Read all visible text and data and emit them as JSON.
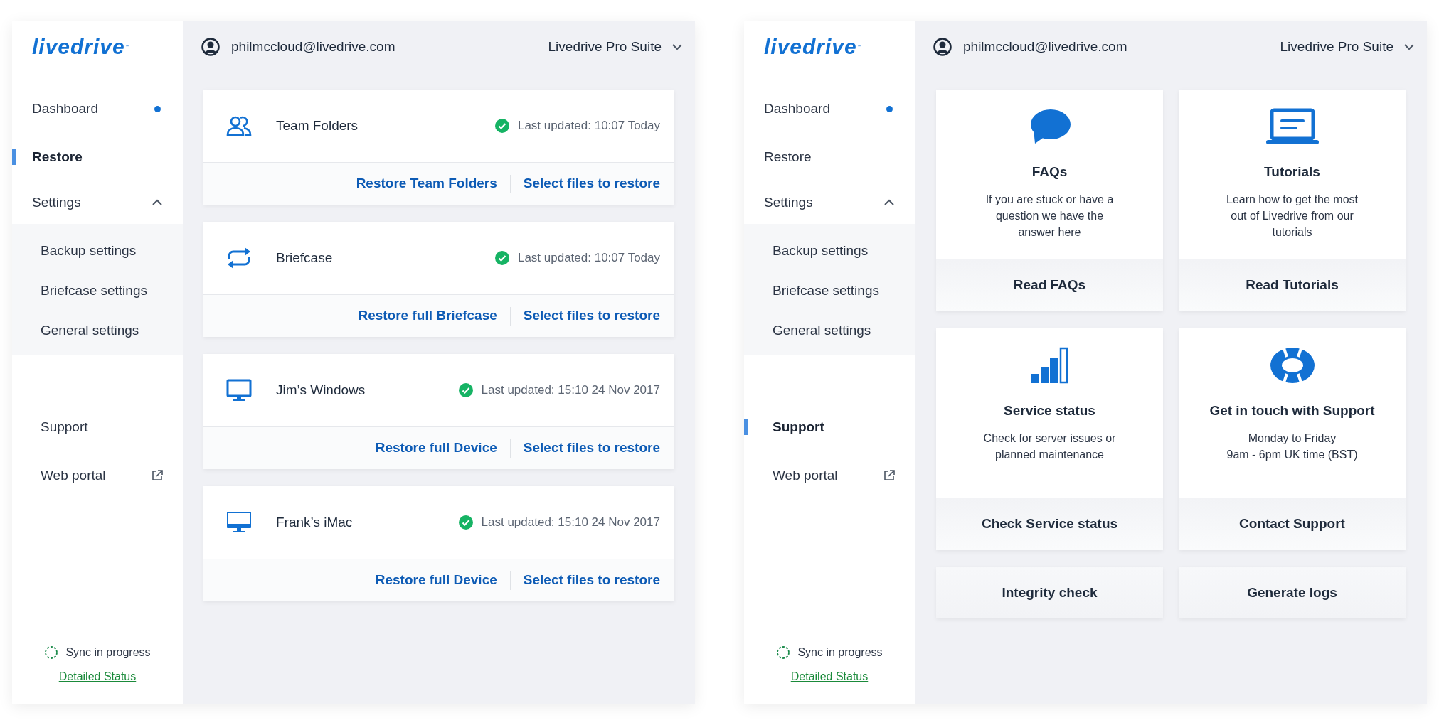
{
  "windows": [
    {
      "logo": "livedrive",
      "trademark": "™",
      "account": {
        "email": "philmccloud@livedrive.com",
        "product": "Livedrive Pro Suite"
      },
      "nav": [
        {
          "label": "Dashboard",
          "kind": "notify",
          "selected": false
        },
        {
          "label": "Restore",
          "kind": "plain",
          "selected": true
        },
        {
          "label": "Settings",
          "kind": "group",
          "selected": false,
          "expanded": true,
          "children": [
            {
              "label": "Backup settings",
              "selected": false
            },
            {
              "label": "Briefcase settings",
              "selected": false
            },
            {
              "label": "General settings",
              "selected": false
            }
          ]
        }
      ],
      "nav_lower": [
        {
          "label": "Support",
          "kind": "plain",
          "selected": false
        },
        {
          "label": "Web portal",
          "kind": "external",
          "selected": false
        }
      ],
      "sync": {
        "status": "Sync in progress",
        "link": "Detailed Status"
      },
      "main": {
        "kind": "restore",
        "backups": [
          {
            "kind": "team",
            "name": "Team Folders",
            "status": "Last updated: 10:07 Today",
            "actions": [
              "Restore Team Folders",
              "Select files to restore"
            ]
          },
          {
            "kind": "briefcase",
            "name": "Briefcase",
            "status": "Last updated: 10:07 Today",
            "actions": [
              "Restore full Briefcase",
              "Select files to restore"
            ]
          },
          {
            "kind": "windows",
            "name": "Jim’s Windows",
            "status": "Last updated: 15:10 24 Nov 2017",
            "actions": [
              "Restore full Device",
              "Select files to restore"
            ]
          },
          {
            "kind": "mac",
            "name": "Frank’s iMac",
            "status": "Last updated: 15:10 24 Nov 2017",
            "actions": [
              "Restore full Device",
              "Select files to restore"
            ]
          }
        ]
      }
    },
    {
      "logo": "livedrive",
      "trademark": "™",
      "account": {
        "email": "philmccloud@livedrive.com",
        "product": "Livedrive Pro Suite"
      },
      "nav": [
        {
          "label": "Dashboard",
          "kind": "notify",
          "selected": false
        },
        {
          "label": "Restore",
          "kind": "plain",
          "selected": false
        },
        {
          "label": "Settings",
          "kind": "group",
          "selected": false,
          "expanded": true,
          "children": [
            {
              "label": "Backup settings",
              "selected": false
            },
            {
              "label": "Briefcase settings",
              "selected": false
            },
            {
              "label": "General settings",
              "selected": false
            }
          ]
        }
      ],
      "nav_lower": [
        {
          "label": "Support",
          "kind": "plain",
          "selected": true
        },
        {
          "label": "Web portal",
          "kind": "external",
          "selected": false
        }
      ],
      "sync": {
        "status": "Sync in progress",
        "link": "Detailed Status"
      },
      "main": {
        "kind": "support",
        "tiles": [
          {
            "kind": "faq",
            "title": "FAQs",
            "lines": [
              "If you are stuck or have a",
              "question we have the",
              "answer here"
            ],
            "action": "Read FAQs"
          },
          {
            "kind": "tutorial",
            "title": "Tutorials",
            "lines": [
              "Learn how to get the most",
              "out of Livedrive from our",
              "tutorials"
            ],
            "action": "Read Tutorials"
          },
          {
            "kind": "status",
            "title": "Service status",
            "lines": [
              "Check for server issues or",
              "planned maintenance"
            ],
            "action": "Check Service status"
          },
          {
            "kind": "contact",
            "title": "Get in touch with Support",
            "lines": [
              "Monday to Friday",
              "9am - 6pm UK time (BST)"
            ],
            "action": "Contact Support"
          },
          {
            "kind": "action",
            "label": "Integrity check"
          },
          {
            "kind": "action",
            "label": "Generate logs"
          }
        ]
      }
    }
  ]
}
